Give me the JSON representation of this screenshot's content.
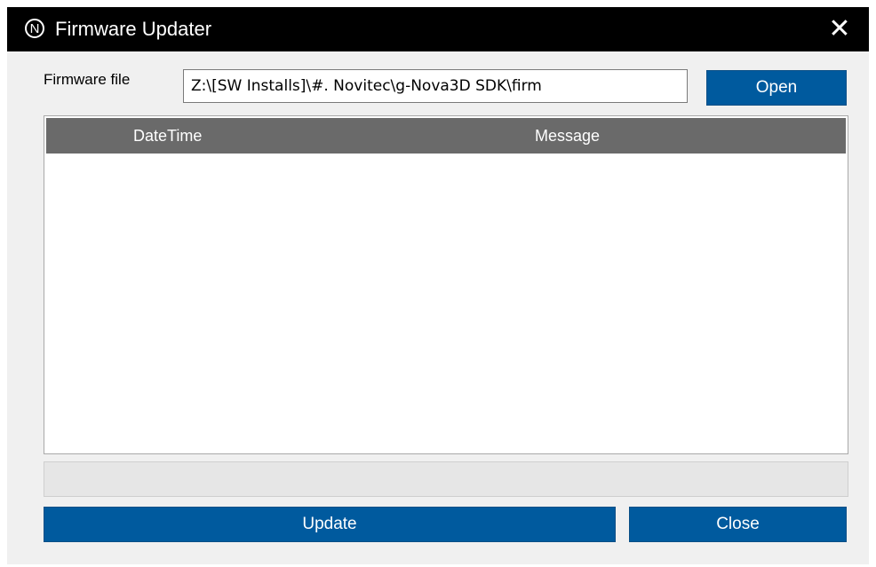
{
  "window": {
    "title": "Firmware Updater",
    "app_icon_glyph": "N",
    "close_glyph": "✕"
  },
  "firmware": {
    "label": "Firmware file",
    "path_value": "Z:\\[SW Installs]\\#. Novitec\\g-Nova3D SDK\\firm",
    "open_label": "Open"
  },
  "log": {
    "columns": [
      "DateTime",
      "Message"
    ],
    "rows": []
  },
  "progress": {
    "value_percent": 0
  },
  "actions": {
    "update_label": "Update",
    "close_label": "Close"
  },
  "colors": {
    "titlebar": "#000000",
    "button": "#005a9e",
    "header": "#6a6a6a"
  },
  "icons": {
    "app": "app-logo-icon",
    "close": "close-icon"
  }
}
